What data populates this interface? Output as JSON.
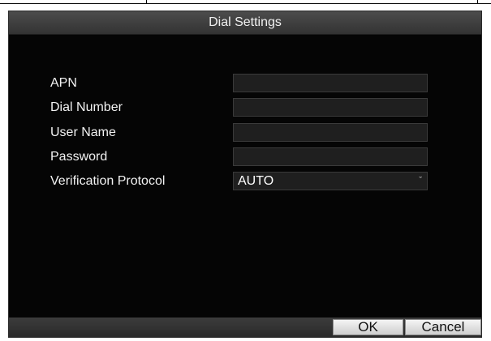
{
  "dialog": {
    "title": "Dial Settings"
  },
  "form": {
    "apn": {
      "label": "APN",
      "value": ""
    },
    "dial_number": {
      "label": "Dial Number",
      "value": ""
    },
    "user_name": {
      "label": "User Name",
      "value": ""
    },
    "password": {
      "label": "Password",
      "value": ""
    },
    "verification_protocol": {
      "label": "Verification Protocol",
      "selected": "AUTO"
    }
  },
  "buttons": {
    "ok_label": "OK",
    "cancel_label": "Cancel"
  },
  "icons": {
    "dropdown": "chevron-down-icon"
  },
  "colors": {
    "dialog_background": "#050505",
    "field_background": "#1f1f1f",
    "text": "#f2f2f2"
  }
}
